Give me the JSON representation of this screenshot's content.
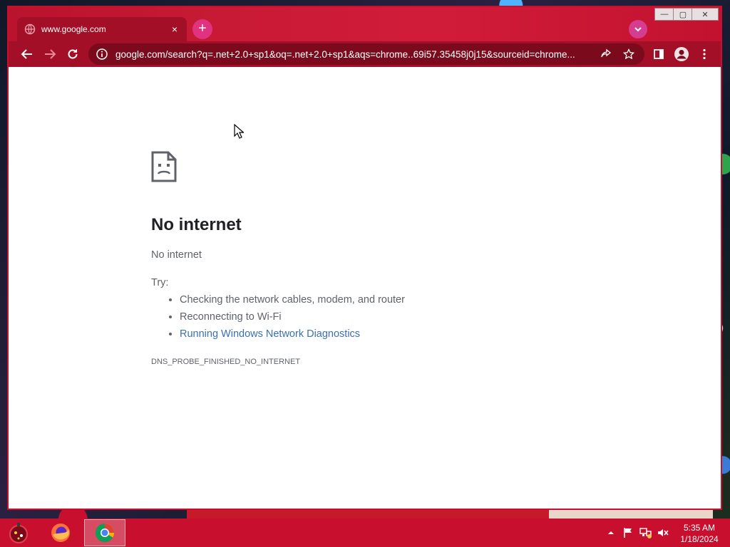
{
  "browser": {
    "tab": {
      "title": "www.google.com",
      "close_glyph": "×"
    },
    "new_tab_glyph": "+",
    "address_bar": {
      "url": "google.com/search?q=.net+2.0+sp1&oq=.net+2.0+sp1&aqs=chrome..69i57.35458j0j15&sourceid=chrome..."
    },
    "window_controls": {
      "minimize": "—",
      "maximize": "▢",
      "close": "✕"
    }
  },
  "error_page": {
    "headline": "No internet",
    "subtext": "No internet",
    "try_label": "Try:",
    "suggestions": [
      "Checking the network cables, modem, and router",
      "Reconnecting to Wi-Fi"
    ],
    "diagnostics_link": "Running Windows Network Diagnostics",
    "error_code": "DNS_PROBE_FINISHED_NO_INTERNET"
  },
  "taskbar": {
    "time": "5:35 AM",
    "date": "1/18/2024"
  },
  "colors": {
    "theme_red": "#c8102e",
    "toolbar_red": "#a30f26",
    "link_blue": "#3a6fb3"
  }
}
